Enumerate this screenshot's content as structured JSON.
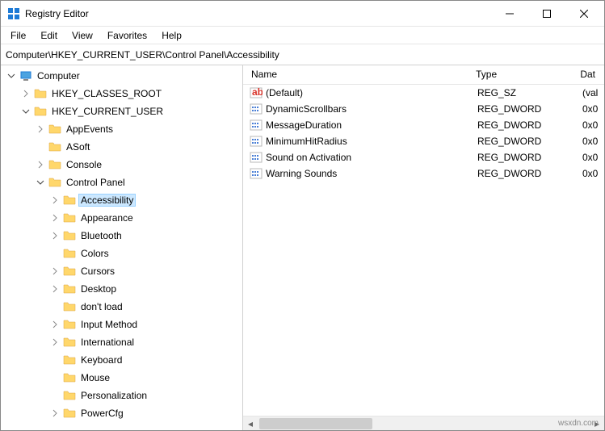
{
  "window": {
    "title": "Registry Editor"
  },
  "menu": [
    "File",
    "Edit",
    "View",
    "Favorites",
    "Help"
  ],
  "address": "Computer\\HKEY_CURRENT_USER\\Control Panel\\Accessibility",
  "tree": [
    {
      "indent": 0,
      "label": "Computer",
      "icon": "computer",
      "exp": "open"
    },
    {
      "indent": 1,
      "label": "HKEY_CLASSES_ROOT",
      "icon": "folder",
      "exp": "closed"
    },
    {
      "indent": 1,
      "label": "HKEY_CURRENT_USER",
      "icon": "folder",
      "exp": "open"
    },
    {
      "indent": 2,
      "label": "AppEvents",
      "icon": "folder",
      "exp": "closed"
    },
    {
      "indent": 2,
      "label": "ASoft",
      "icon": "folder",
      "exp": "none"
    },
    {
      "indent": 2,
      "label": "Console",
      "icon": "folder",
      "exp": "closed"
    },
    {
      "indent": 2,
      "label": "Control Panel",
      "icon": "folder",
      "exp": "open"
    },
    {
      "indent": 3,
      "label": "Accessibility",
      "icon": "folder",
      "exp": "closed",
      "selected": true
    },
    {
      "indent": 3,
      "label": "Appearance",
      "icon": "folder",
      "exp": "closed"
    },
    {
      "indent": 3,
      "label": "Bluetooth",
      "icon": "folder",
      "exp": "closed"
    },
    {
      "indent": 3,
      "label": "Colors",
      "icon": "folder",
      "exp": "none"
    },
    {
      "indent": 3,
      "label": "Cursors",
      "icon": "folder",
      "exp": "closed"
    },
    {
      "indent": 3,
      "label": "Desktop",
      "icon": "folder",
      "exp": "closed"
    },
    {
      "indent": 3,
      "label": "don't load",
      "icon": "folder",
      "exp": "none"
    },
    {
      "indent": 3,
      "label": "Input Method",
      "icon": "folder",
      "exp": "closed"
    },
    {
      "indent": 3,
      "label": "International",
      "icon": "folder",
      "exp": "closed"
    },
    {
      "indent": 3,
      "label": "Keyboard",
      "icon": "folder",
      "exp": "none"
    },
    {
      "indent": 3,
      "label": "Mouse",
      "icon": "folder",
      "exp": "none"
    },
    {
      "indent": 3,
      "label": "Personalization",
      "icon": "folder",
      "exp": "none"
    },
    {
      "indent": 3,
      "label": "PowerCfg",
      "icon": "folder",
      "exp": "closed"
    }
  ],
  "columns": {
    "name": "Name",
    "type": "Type",
    "data": "Dat"
  },
  "values": [
    {
      "name": "(Default)",
      "type": "REG_SZ",
      "data": "(val",
      "icon": "sz"
    },
    {
      "name": "DynamicScrollbars",
      "type": "REG_DWORD",
      "data": "0x0",
      "icon": "dw"
    },
    {
      "name": "MessageDuration",
      "type": "REG_DWORD",
      "data": "0x0",
      "icon": "dw"
    },
    {
      "name": "MinimumHitRadius",
      "type": "REG_DWORD",
      "data": "0x0",
      "icon": "dw"
    },
    {
      "name": "Sound on Activation",
      "type": "REG_DWORD",
      "data": "0x0",
      "icon": "dw"
    },
    {
      "name": "Warning Sounds",
      "type": "REG_DWORD",
      "data": "0x0",
      "icon": "dw"
    }
  ],
  "watermark": "wsxdn.com"
}
